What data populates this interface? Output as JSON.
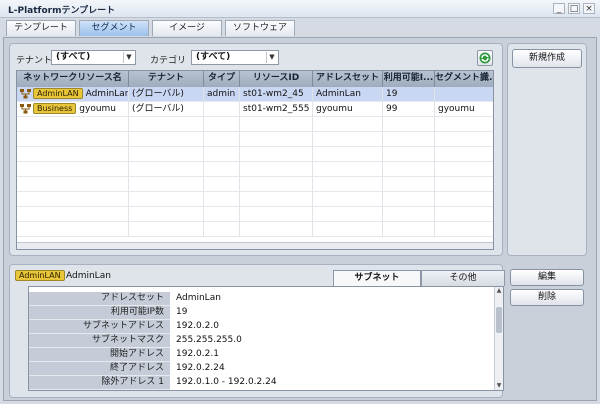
{
  "window": {
    "title": "L-Platformテンプレート",
    "min": "_",
    "max": "□",
    "close": "×"
  },
  "tabs": [
    {
      "label": "テンプレート",
      "active": false
    },
    {
      "label": "セグメント",
      "active": true
    },
    {
      "label": "イメージ",
      "active": false
    },
    {
      "label": "ソフトウェア",
      "active": false
    }
  ],
  "filters": {
    "tenant_label": "テナント",
    "tenant_value": "(すべて)",
    "category_label": "カテゴリ",
    "category_value": "(すべて)"
  },
  "table": {
    "columns": [
      "ネットワークリソース名",
      "テナント",
      "タイプ",
      "リソースID",
      "アドレスセット",
      "利用可能I...",
      "セグメント識..."
    ],
    "rows": [
      {
        "badge": "AdminLAN",
        "name": "AdminLan",
        "tenant": "(グローバル)",
        "type": "admin",
        "resource_id": "st01-wm2_45",
        "address_set": "AdminLan",
        "available": "19",
        "segment": ""
      },
      {
        "badge": "Business",
        "name": "gyoumu",
        "tenant": "(グローバル)",
        "type": "",
        "resource_id": "st01-wm2_555",
        "address_set": "gyoumu",
        "available": "99",
        "segment": "gyoumu"
      }
    ]
  },
  "actions": {
    "new": "新規作成",
    "edit": "編集",
    "delete": "削除"
  },
  "detail": {
    "badge": "AdminLAN",
    "name": "AdminLan",
    "tabs": [
      {
        "label": "サブネット",
        "active": true
      },
      {
        "label": "その他",
        "active": false
      }
    ],
    "rows": [
      {
        "key": "アドレスセット",
        "value": "AdminLan"
      },
      {
        "key": "利用可能IP数",
        "value": "19"
      },
      {
        "key": "サブネットアドレス",
        "value": "192.0.2.0"
      },
      {
        "key": "サブネットマスク",
        "value": "255.255.255.0"
      },
      {
        "key": "開始アドレス",
        "value": "192.0.2.1"
      },
      {
        "key": "終了アドレス",
        "value": "192.0.2.24"
      },
      {
        "key": "除外アドレス 1",
        "value": "192.0.1.0 - 192.0.2.24"
      }
    ]
  },
  "colors": {
    "badge": "#e9c53a",
    "selected_row": "#c9d7f3",
    "active_tab": "#9cc1eb"
  }
}
